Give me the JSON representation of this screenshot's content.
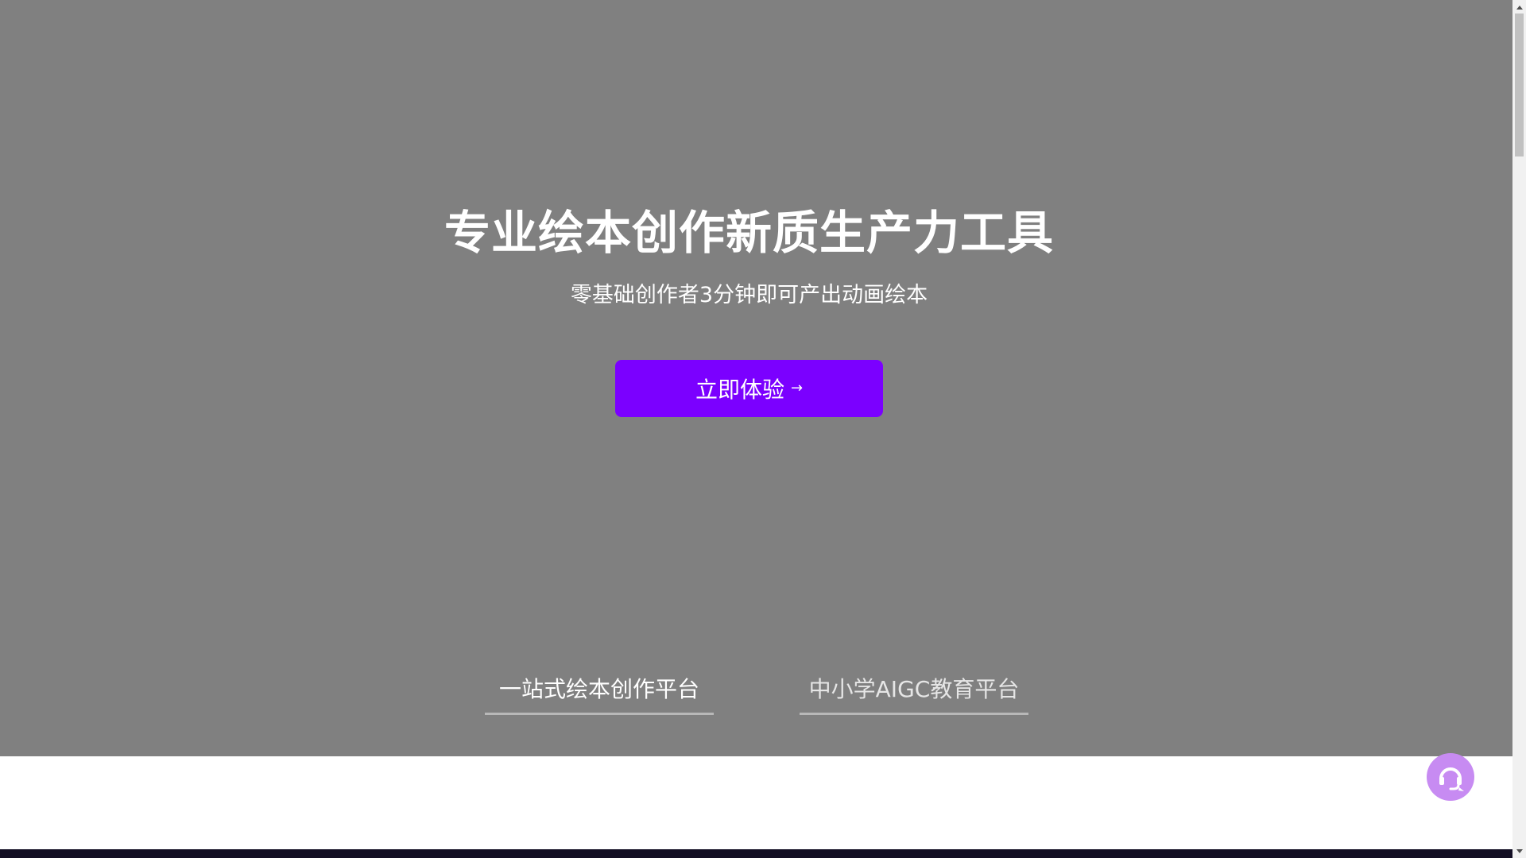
{
  "hero": {
    "title": "专业绘本创作新质生产力工具",
    "subtitle": "零基础创作者3分钟即可产出动画绘本",
    "cta_label": "立即体验",
    "cta_arrow": "→",
    "background_color": "#808080",
    "accent_color": "#7b00ff"
  },
  "tabs": [
    {
      "label": "一站式绘本创作平台",
      "active": true
    },
    {
      "label": "中小学AIGC教育平台",
      "active": false
    }
  ],
  "support": {
    "icon": "headset-chat-icon",
    "color": "#c78bf2"
  },
  "footer": {
    "band_color": "#130f24"
  }
}
